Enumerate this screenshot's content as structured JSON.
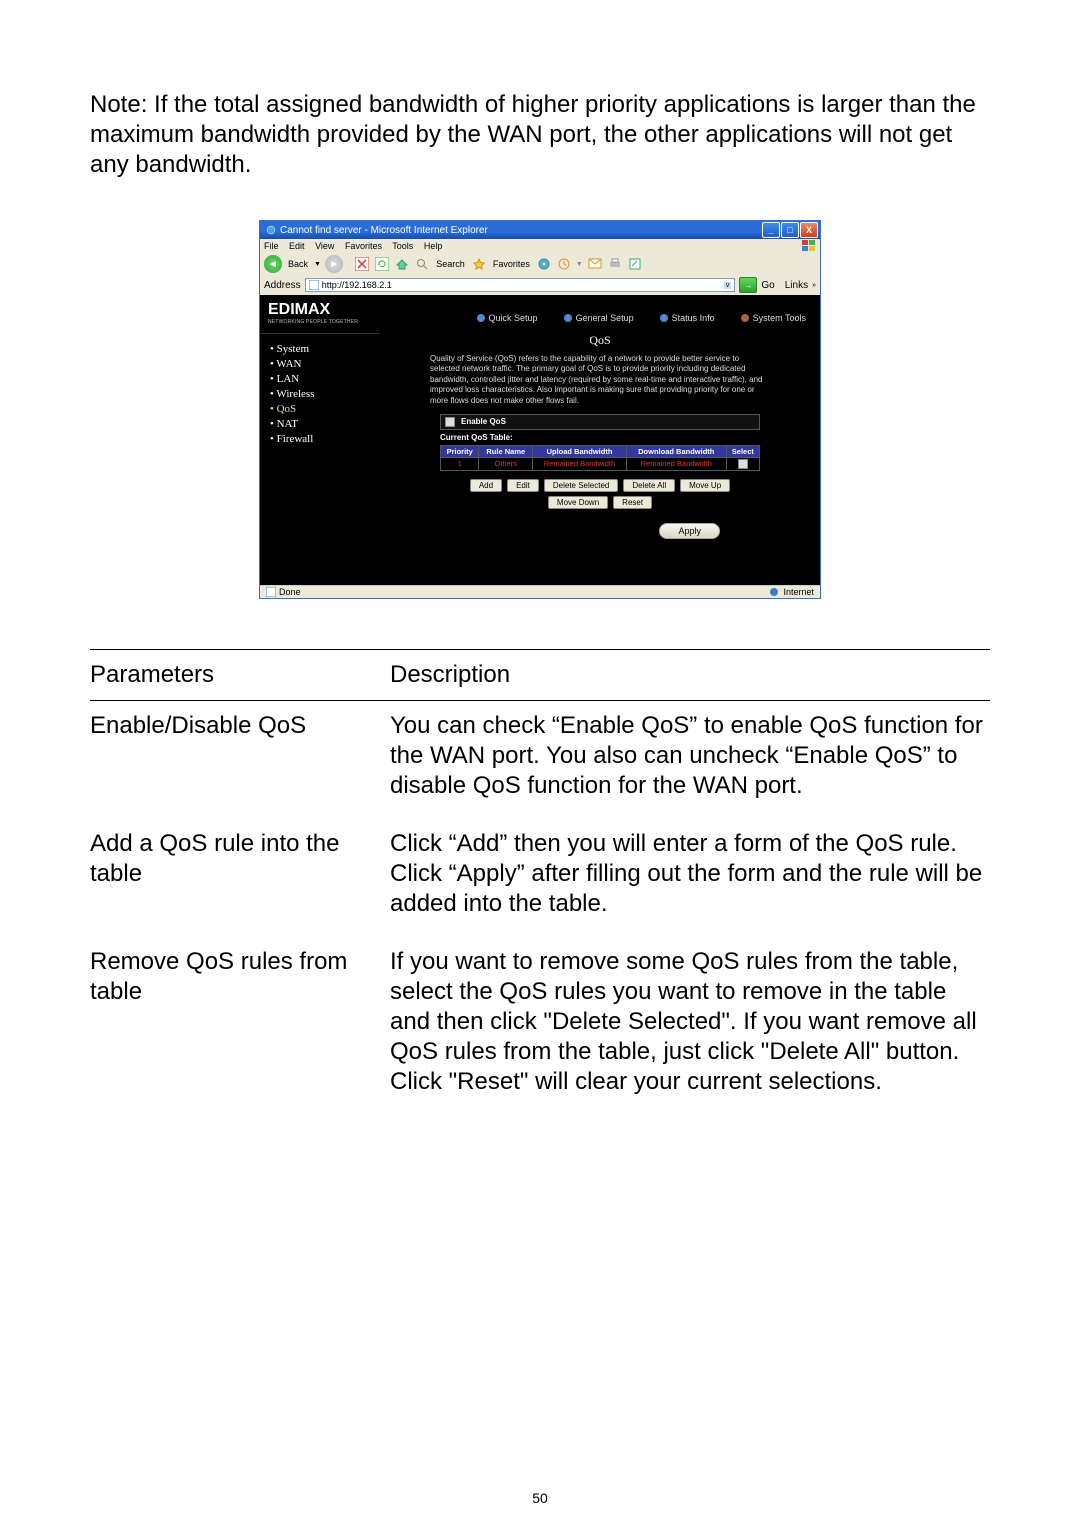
{
  "note": "Note: If the total assigned bandwidth of higher priority applications is larger than the maximum bandwidth provided by the WAN port, the other applications will not get any bandwidth.",
  "ie": {
    "title": "Cannot find server - Microsoft Internet Explorer",
    "menu": {
      "file": "File",
      "edit": "Edit",
      "view": "View",
      "favorites": "Favorites",
      "tools": "Tools",
      "help": "Help"
    },
    "toolbar": {
      "back": "Back",
      "search": "Search",
      "favorites": "Favorites"
    },
    "address_label": "Address",
    "address_value": "http://192.168.2.1",
    "go": "Go",
    "links": "Links",
    "status_left": "Done",
    "status_right": "Internet"
  },
  "router": {
    "brand": "EDIMAX",
    "tagline": "NETWORKING PEOPLE TOGETHER",
    "tabs": {
      "quick": "Quick Setup",
      "general": "General Setup",
      "status": "Status Info",
      "tools": "System Tools"
    },
    "menu": {
      "system": "System",
      "wan": "WAN",
      "lan": "LAN",
      "wireless": "Wireless",
      "qos": "QoS",
      "nat": "NAT",
      "firewall": "Firewall"
    },
    "panel_title": "QoS",
    "desc": "Quality of Service (QoS) refers to the capability of a network to provide better service to selected network traffic. The primary goal of QoS is to provide priority including dedicated bandwidth, controlled jitter and latency (required by some real-time and interactive traffic), and improved loss characteristics. Also important is making sure that providing priority for one or more flows does not make other flows fail.",
    "enable_label": "Enable QoS",
    "current_label": "Current QoS Table:",
    "thead": {
      "priority": "Priority",
      "rule": "Rule Name",
      "up": "Upload Bandwidth",
      "down": "Download Bandwidth",
      "select": "Select"
    },
    "row": {
      "priority": "1",
      "rule": "Others",
      "up": "Remained Bandwidth",
      "down": "Remained Bandwidth"
    },
    "buttons": {
      "add": "Add",
      "edit": "Edit",
      "del_sel": "Delete Selected",
      "del_all": "Delete All",
      "move_up": "Move Up",
      "move_down": "Move Down",
      "reset": "Reset",
      "apply": "Apply"
    }
  },
  "params": {
    "header": {
      "p": "Parameters",
      "d": "Description"
    },
    "rows": [
      {
        "p": "Enable/Disable QoS",
        "d": "You can check “Enable QoS” to enable QoS function for the WAN port. You also can uncheck “Enable QoS” to disable QoS function for the WAN port."
      },
      {
        "p": "Add a QoS rule into the table",
        "d": "Click “Add” then you will enter a form of the QoS rule. Click “Apply” after filling out the form and the rule will be added into the table."
      },
      {
        "p": "Remove QoS rules from table",
        "d": "If you want to remove some QoS rules from the table, select the QoS rules you want to remove in the table and then click \"Delete Selected\". If you want remove all QoS rules from the table, just click \"Delete All\" button. Click \"Reset\" will clear your current selections."
      }
    ]
  },
  "page_number": "50"
}
